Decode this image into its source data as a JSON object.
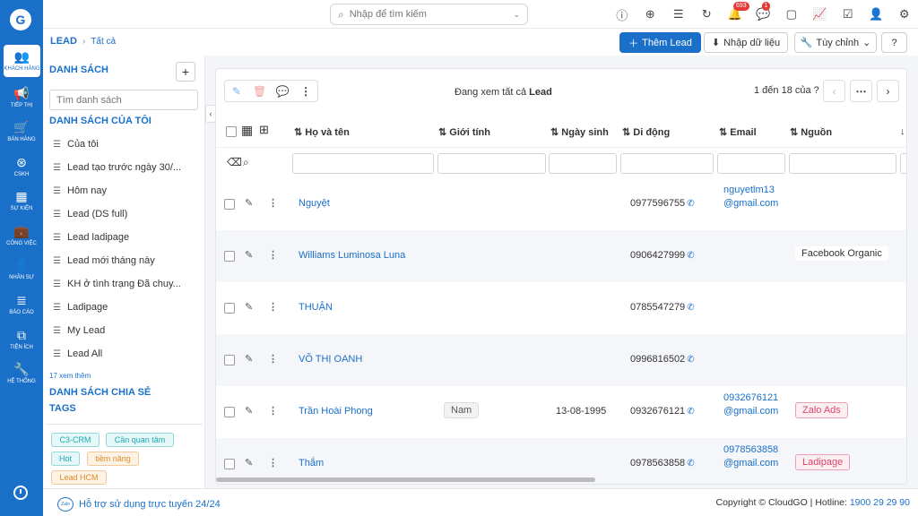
{
  "nav": [
    {
      "label": "KHÁCH HÀNG",
      "icon": "users-icon",
      "glyph": "👥"
    },
    {
      "label": "TIẾP THỊ",
      "icon": "megaphone-icon",
      "glyph": "📢"
    },
    {
      "label": "BÁN HÀNG",
      "icon": "cart-icon",
      "glyph": "🛒"
    },
    {
      "label": "CSKH",
      "icon": "support-icon",
      "glyph": "⊛"
    },
    {
      "label": "SỰ KIỆN",
      "icon": "calendar-icon",
      "glyph": "▦"
    },
    {
      "label": "CÔNG VIỆC",
      "icon": "briefcase-icon",
      "glyph": "💼"
    },
    {
      "label": "NHÂN SỰ",
      "icon": "person-icon",
      "glyph": "👤"
    },
    {
      "label": "BÁO CÁO",
      "icon": "report-icon",
      "glyph": "≣"
    },
    {
      "label": "TIỆN ÍCH",
      "icon": "utility-icon",
      "glyph": "⧉"
    },
    {
      "label": "HỆ THỐNG",
      "icon": "wrench-icon",
      "glyph": "🔧"
    }
  ],
  "search": {
    "placeholder": "Nhập để tìm kiếm"
  },
  "top_icons": [
    {
      "icon": "alert-icon",
      "glyph": "ⓘ"
    },
    {
      "icon": "add-circle-icon",
      "glyph": "⊕"
    },
    {
      "icon": "list-icon",
      "glyph": "☰"
    },
    {
      "icon": "refresh-icon",
      "glyph": "↻"
    },
    {
      "icon": "bell-icon",
      "glyph": "🔔",
      "badge": "693"
    },
    {
      "icon": "chat-icon",
      "glyph": "💬",
      "badge": "1"
    },
    {
      "icon": "calendar-icon",
      "glyph": "▢"
    },
    {
      "icon": "chart-icon",
      "glyph": "📈"
    },
    {
      "icon": "task-icon",
      "glyph": "☑"
    },
    {
      "icon": "user-icon",
      "glyph": "👤"
    },
    {
      "icon": "settings-icon",
      "glyph": "⚙"
    }
  ],
  "breadcrumb": {
    "module": "LEAD",
    "current": "Tất cả"
  },
  "actions": {
    "add": "Thêm Lead",
    "import": "Nhập dữ liệu",
    "custom": "Tùy chỉnh"
  },
  "left_panel": {
    "title": "DANH SÁCH",
    "search_placeholder": "Tìm danh sách",
    "my_lists": "DANH SÁCH CỦA TÔI",
    "items": [
      "Của tôi",
      "Lead tạo trước ngày 30/...",
      "Hôm nay",
      "Lead (DS full)",
      "Lead ladipage",
      "Lead mới tháng này",
      "KH ở tình trạng Đã chuy...",
      "Ladipage",
      "My Lead",
      "Lead All"
    ],
    "more": "17 xem thêm",
    "shared": "DANH SÁCH CHIA SẺ",
    "tags_title": "TAGS",
    "tags": [
      "C3-CRM",
      "Cần quan tâm",
      "Hot",
      "tiềm năng",
      "Lead HCM"
    ]
  },
  "viewing": {
    "prefix": "Đang xem tất cả",
    "module": "Lead"
  },
  "pager": {
    "text": "1 đến 18 của ?"
  },
  "columns": [
    "Họ và tên",
    "Giới tính",
    "Ngày sinh",
    "Di động",
    "Email",
    "Nguồn"
  ],
  "rows": [
    {
      "name": "Nguyệt",
      "gender": "",
      "dob": "",
      "mobile": "0977596755",
      "email": "nguyetlm13@gmail.com",
      "source": ""
    },
    {
      "name": "Williams Luminosa Luna",
      "gender": "",
      "dob": "",
      "mobile": "0906427999",
      "email": "",
      "source": "Facebook Organic"
    },
    {
      "name": "THUẬN",
      "gender": "",
      "dob": "",
      "mobile": "0785547279",
      "email": "",
      "source": ""
    },
    {
      "name": "VÕ THỊ OANH",
      "gender": "",
      "dob": "",
      "mobile": "0996816502",
      "email": "",
      "source": ""
    },
    {
      "name": "Trần Hoài Phong",
      "gender": "Nam",
      "dob": "13-08-1995",
      "mobile": "0932676121",
      "email": "0932676121@gmail.com",
      "source": "Zalo Ads"
    },
    {
      "name": "Thắm",
      "gender": "",
      "dob": "",
      "mobile": "0978563858",
      "email": "0978563858@gmail.com",
      "source": "Ladipage"
    }
  ],
  "footer": {
    "support": "Hỗ trợ sử dụng trực tuyến 24/24",
    "copyright": "Copyright © CloudGO | Hotline: ",
    "hotline": "1900 29 29 90"
  }
}
